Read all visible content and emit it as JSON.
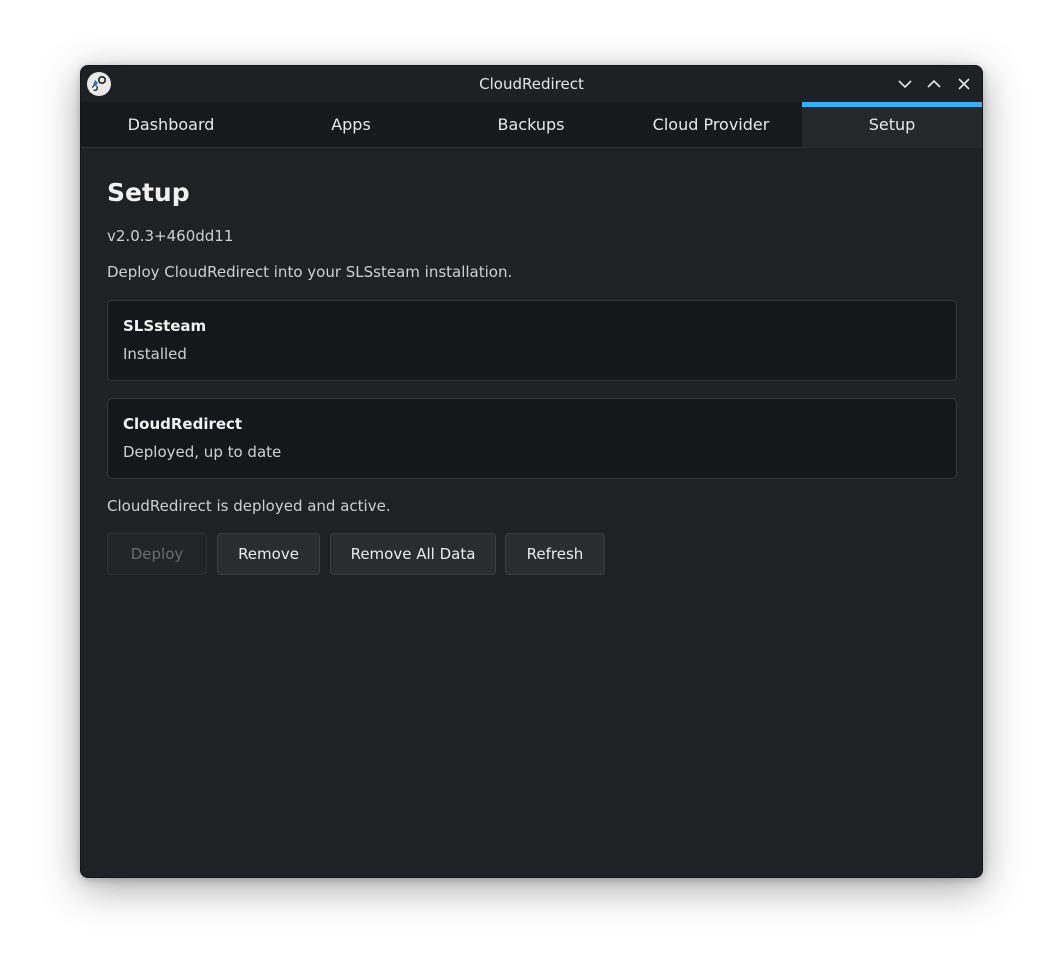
{
  "window": {
    "title": "CloudRedirect"
  },
  "tabs": [
    {
      "label": "Dashboard",
      "active": false
    },
    {
      "label": "Apps",
      "active": false
    },
    {
      "label": "Backups",
      "active": false
    },
    {
      "label": "Cloud Provider",
      "active": false
    },
    {
      "label": "Setup",
      "active": true
    }
  ],
  "page": {
    "title": "Setup",
    "version": "v2.0.3+460dd11",
    "description": "Deploy CloudRedirect into your SLSsteam installation."
  },
  "components": [
    {
      "name": "SLSsteam",
      "status": "Installed"
    },
    {
      "name": "CloudRedirect",
      "status": "Deployed, up to date"
    }
  ],
  "status_message": "CloudRedirect is deployed and active.",
  "actions": {
    "deploy": {
      "label": "Deploy",
      "enabled": false
    },
    "remove": {
      "label": "Remove",
      "enabled": true
    },
    "remove_all": {
      "label": "Remove All Data",
      "enabled": true
    },
    "refresh": {
      "label": "Refresh",
      "enabled": true
    }
  },
  "colors": {
    "accent": "#3daee9",
    "window_bg": "#202124",
    "card_bg": "#16171a"
  },
  "icons": [
    "app-logo-icon",
    "minimize-icon",
    "maximize-icon",
    "close-icon"
  ]
}
